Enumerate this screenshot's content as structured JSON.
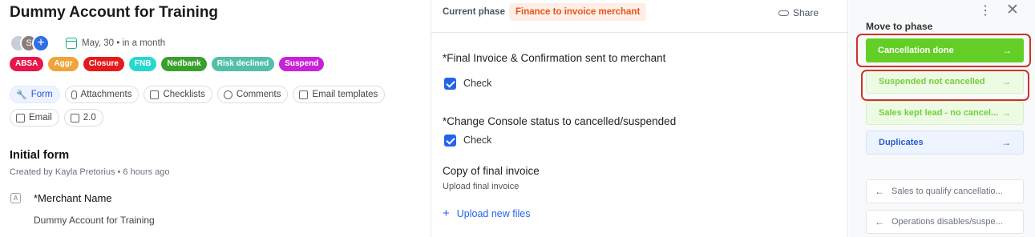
{
  "card": {
    "title": "Dummy Account for Training",
    "due_date": "May, 30 • in a month",
    "avatars": [
      "",
      "S",
      "+"
    ],
    "labels": [
      {
        "text": "ABSA",
        "color": "#e8164a"
      },
      {
        "text": "Aggr",
        "color": "#f0a33a"
      },
      {
        "text": "Closure",
        "color": "#e31b1b"
      },
      {
        "text": "FNB",
        "color": "#26d9d0"
      },
      {
        "text": "Nedbank",
        "color": "#3aa02c"
      },
      {
        "text": "Risk declined",
        "color": "#52bfa8"
      },
      {
        "text": "Suspend",
        "color": "#c822d6"
      }
    ],
    "tabs": [
      {
        "label": "Form",
        "icon": "wrench-icon"
      },
      {
        "label": "Attachments",
        "icon": "paperclip-icon"
      },
      {
        "label": "Checklists",
        "icon": "checklist-icon"
      },
      {
        "label": "Comments",
        "icon": "comment-icon"
      },
      {
        "label": "Email templates",
        "icon": "mail-template-icon"
      },
      {
        "label": "Email",
        "icon": "mail-icon"
      },
      {
        "label": "2.0",
        "icon": "connections-icon"
      }
    ],
    "form": {
      "title": "Initial form",
      "subtitle": "Created by Kayla Pretorius • 6 hours ago",
      "field_label": "*Merchant Name",
      "field_icon": "A",
      "field_value": "Dummy Account for Training"
    }
  },
  "phase": {
    "label": "Current phase",
    "value": "Finance to invoice merchant",
    "share": "Share",
    "items": [
      {
        "title": "*Final Invoice & Confirmation sent to merchant",
        "check": "Check"
      },
      {
        "title": "*Change Console status to cancelled/suspended",
        "check": "Check"
      }
    ],
    "copy_title": "Copy of final invoice",
    "copy_sub": "Upload final invoice",
    "upload": "Upload new files"
  },
  "move": {
    "title": "Move to phase",
    "forward": [
      "Cancellation done",
      "Suspended not cancelled",
      "Sales kept lead - no cancel...",
      "Duplicates"
    ],
    "back": [
      "Sales to qualify cancellatio...",
      "Operations disables/suspe..."
    ],
    "arrow_forward": "→",
    "arrow_back": "←",
    "kebab": "⋮",
    "close": "✕"
  }
}
